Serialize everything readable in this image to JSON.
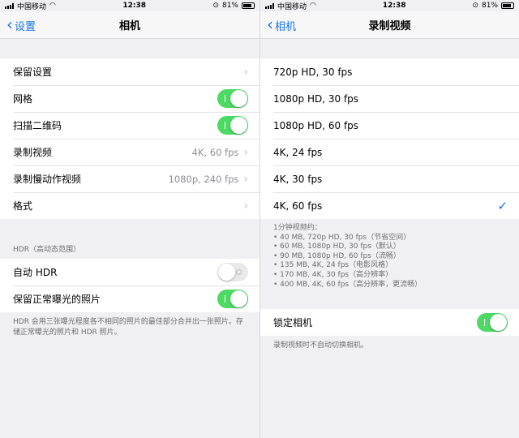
{
  "left": {
    "status": {
      "carrier": "中国移动",
      "time": "12:38",
      "battery": "81%"
    },
    "nav": {
      "back": "设置",
      "title": "相机"
    },
    "group1": [
      {
        "label": "保留设置",
        "value": "",
        "control": "chevron"
      },
      {
        "label": "网格",
        "value": "",
        "control": "toggle-on"
      },
      {
        "label": "扫描二维码",
        "value": "",
        "control": "toggle-on"
      },
      {
        "label": "录制视频",
        "value": "4K, 60 fps",
        "control": "chevron"
      },
      {
        "label": "录制慢动作视频",
        "value": "1080p, 240 fps",
        "control": "chevron"
      },
      {
        "label": "格式",
        "value": "",
        "control": "chevron"
      }
    ],
    "hdr_header": "HDR（高动态范围）",
    "group2": [
      {
        "label": "自动 HDR",
        "control": "toggle-off"
      },
      {
        "label": "保留正常曝光的照片",
        "control": "toggle-on"
      }
    ],
    "hdr_footer": "HDR 会用三张曝光程度各不相同的照片的最佳部分合并出一张照片。存储正常曝光的照片和 HDR 照片。"
  },
  "right": {
    "status": {
      "carrier": "中国移动",
      "time": "12:38",
      "battery": "81%"
    },
    "nav": {
      "back": "相机",
      "title": "录制视频"
    },
    "options": [
      {
        "label": "720p HD, 30 fps",
        "selected": false
      },
      {
        "label": "1080p HD, 30 fps",
        "selected": false
      },
      {
        "label": "1080p HD, 60 fps",
        "selected": false
      },
      {
        "label": "4K, 24 fps",
        "selected": false
      },
      {
        "label": "4K, 30 fps",
        "selected": false
      },
      {
        "label": "4K, 60 fps",
        "selected": true
      }
    ],
    "check_glyph": "✓",
    "size_info": [
      "1分钟视频约：",
      "• 40 MB, 720p HD, 30 fps（节省空间）",
      "• 60 MB, 1080p HD, 30 fps（默认）",
      "• 90 MB, 1080p HD, 60 fps（流畅）",
      "• 135 MB, 4K, 24 fps（电影风格）",
      "• 170 MB, 4K, 30 fps（高分辨率）",
      "• 400 MB, 4K, 60 fps（高分辨率，更流畅）"
    ],
    "lock": {
      "label": "锁定相机",
      "control": "toggle-on"
    },
    "lock_footer": "录制视频时不自动切换相机。"
  }
}
